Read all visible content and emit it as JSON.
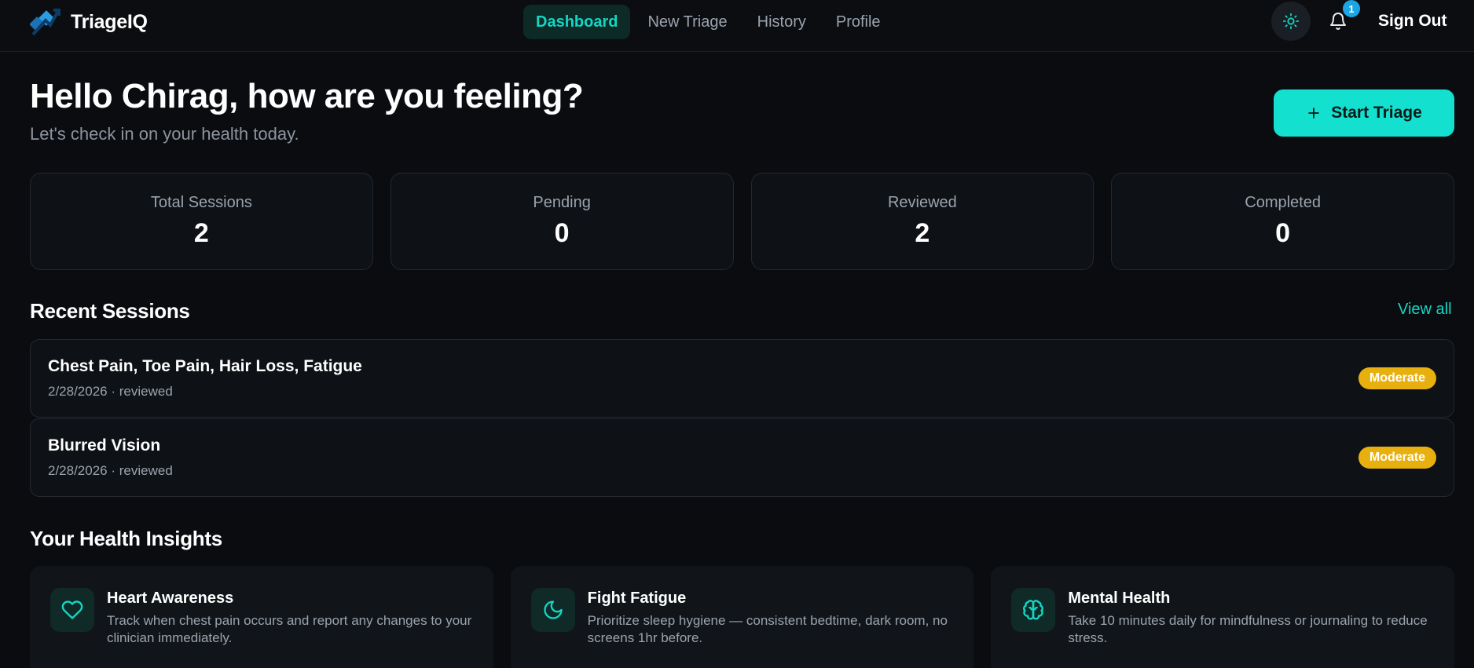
{
  "brand": {
    "name": "TriageIQ"
  },
  "nav": [
    {
      "label": "Dashboard",
      "active": true
    },
    {
      "label": "New Triage",
      "active": false
    },
    {
      "label": "History",
      "active": false
    },
    {
      "label": "Profile",
      "active": false
    }
  ],
  "header": {
    "theme_icon": "sun-icon",
    "bell_icon": "bell-icon",
    "notification_count": "1",
    "sign_out": "Sign Out"
  },
  "hero": {
    "greeting": "Hello Chirag, how are you feeling?",
    "subtitle": "Let's check in on your health today.",
    "start_button": "Start Triage"
  },
  "stats": [
    {
      "label": "Total Sessions",
      "value": "2"
    },
    {
      "label": "Pending",
      "value": "0"
    },
    {
      "label": "Reviewed",
      "value": "2"
    },
    {
      "label": "Completed",
      "value": "0"
    }
  ],
  "recent": {
    "title": "Recent Sessions",
    "view_all": "View all",
    "sessions": [
      {
        "title": "Chest Pain, Toe Pain, Hair Loss, Fatigue",
        "meta": "2/28/2026 · reviewed",
        "severity": "Moderate"
      },
      {
        "title": "Blurred Vision",
        "meta": "2/28/2026 · reviewed",
        "severity": "Moderate"
      }
    ]
  },
  "insights": {
    "title": "Your Health Insights",
    "cards": [
      {
        "icon": "heart-icon",
        "title": "Heart Awareness",
        "desc": "Track when chest pain occurs and report any changes to your clinician immediately."
      },
      {
        "icon": "moon-icon",
        "title": "Fight Fatigue",
        "desc": "Prioritize sleep hygiene — consistent bedtime, dark room, no screens 1hr before."
      },
      {
        "icon": "brain-icon",
        "title": "Mental Health",
        "desc": "Take 10 minutes daily for mindfulness or journaling to reduce stress."
      }
    ]
  },
  "colors": {
    "accent": "#14E0CF",
    "background": "#0A0C10",
    "card": "#0E1116",
    "severity_moderate": "#E8B00E",
    "badge": "#1AA5E6"
  }
}
